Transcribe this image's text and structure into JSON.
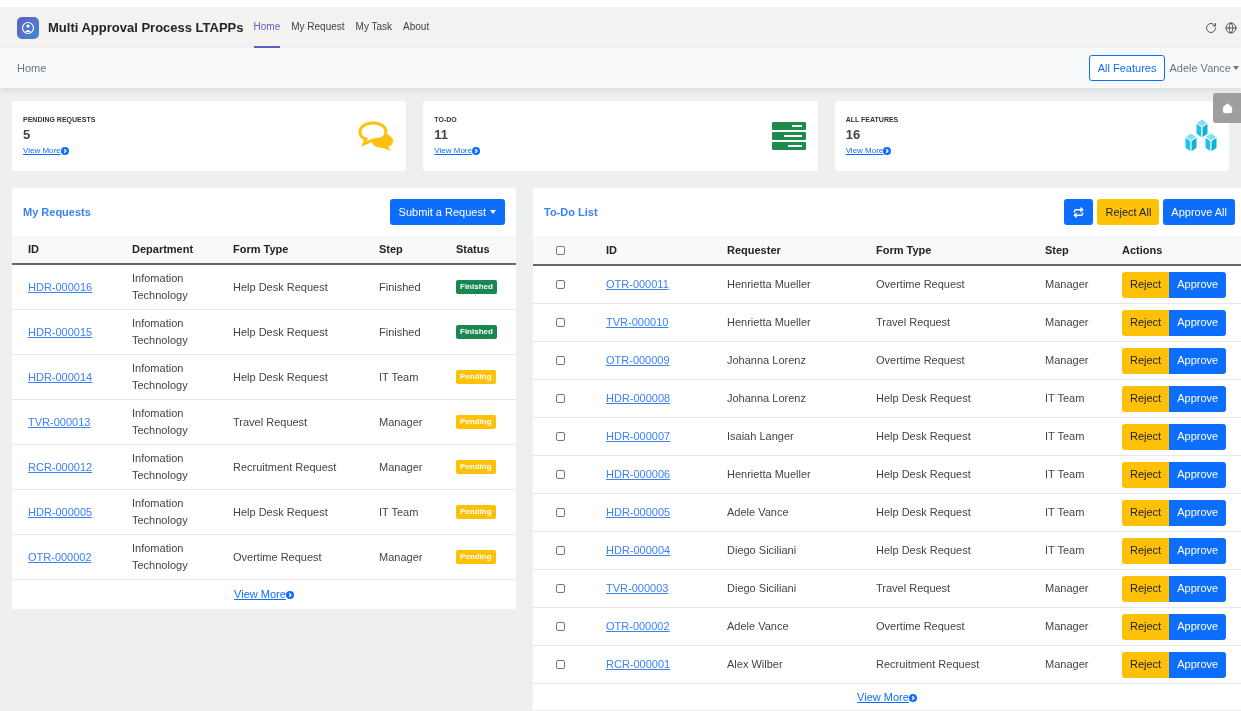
{
  "app": {
    "title": "Multi Approval Process LTAPPs"
  },
  "nav": [
    {
      "label": "Home",
      "selected": true
    },
    {
      "label": "My Request",
      "selected": false
    },
    {
      "label": "My Task",
      "selected": false
    },
    {
      "label": "About",
      "selected": false
    }
  ],
  "breadcrumb": "Home",
  "all_features_button": "All Features",
  "user_menu": "Adele Vance",
  "stats": [
    {
      "kind": "chat",
      "title": "PENDING REQUESTS",
      "value": "5",
      "link": "View More"
    },
    {
      "kind": "list",
      "title": "TO-DO",
      "value": "11",
      "link": "View More"
    },
    {
      "kind": "cubes",
      "title": "ALL FEATURES",
      "value": "16",
      "link": "View More"
    }
  ],
  "my_requests": {
    "title": "My Requests",
    "button": "Submit a Request",
    "columns": [
      "ID",
      "Department",
      "Form Type",
      "Step",
      "Status"
    ],
    "rows": [
      {
        "id": "HDR-000016",
        "department": "Infomation Technology",
        "form_type": "Help Desk Request",
        "step": "Finished",
        "status": {
          "kind": "finished",
          "label": "Finished"
        }
      },
      {
        "id": "HDR-000015",
        "department": "Infomation Technology",
        "form_type": "Help Desk Request",
        "step": "Finished",
        "status": {
          "kind": "finished",
          "label": "Finished"
        }
      },
      {
        "id": "HDR-000014",
        "department": "Infomation Technology",
        "form_type": "Help Desk Request",
        "step": "IT Team",
        "status": {
          "kind": "pending",
          "label": "Pending"
        }
      },
      {
        "id": "TVR-000013",
        "department": "Infomation Technology",
        "form_type": "Travel Request",
        "step": "Manager",
        "status": {
          "kind": "pending",
          "label": "Pending"
        }
      },
      {
        "id": "RCR-000012",
        "department": "Infomation Technology",
        "form_type": "Recruitment Request",
        "step": "Manager",
        "status": {
          "kind": "pending",
          "label": "Pending"
        }
      },
      {
        "id": "HDR-000005",
        "department": "Infomation Technology",
        "form_type": "Help Desk Request",
        "step": "IT Team",
        "status": {
          "kind": "pending",
          "label": "Pending"
        }
      },
      {
        "id": "OTR-000002",
        "department": "Infomation Technology",
        "form_type": "Overtime Request",
        "step": "Manager",
        "status": {
          "kind": "pending",
          "label": "Pending"
        }
      }
    ],
    "view_more": "View More"
  },
  "todo": {
    "title": "To-Do List",
    "reject_all": "Reject All",
    "approve_all": "Approve All",
    "select_all_checked": false,
    "columns": [
      "ID",
      "Requester",
      "Form Type",
      "Step",
      "Actions"
    ],
    "rows": [
      {
        "checked": false,
        "id": "OTR-000011",
        "requester": "Henrietta Mueller",
        "form_type": "Overtime Request",
        "step": "Manager",
        "reject": "Reject",
        "approve": "Approve"
      },
      {
        "checked": false,
        "id": "TVR-000010",
        "requester": "Henrietta Mueller",
        "form_type": "Travel Request",
        "step": "Manager",
        "reject": "Reject",
        "approve": "Approve"
      },
      {
        "checked": false,
        "id": "OTR-000009",
        "requester": "Johanna Lorenz",
        "form_type": "Overtime Request",
        "step": "Manager",
        "reject": "Reject",
        "approve": "Approve"
      },
      {
        "checked": false,
        "id": "HDR-000008",
        "requester": "Johanna Lorenz",
        "form_type": "Help Desk Request",
        "step": "IT Team",
        "reject": "Reject",
        "approve": "Approve"
      },
      {
        "checked": false,
        "id": "HDR-000007",
        "requester": "Isaiah Langer",
        "form_type": "Help Desk Request",
        "step": "IT Team",
        "reject": "Reject",
        "approve": "Approve"
      },
      {
        "checked": false,
        "id": "HDR-000006",
        "requester": "Henrietta Mueller",
        "form_type": "Help Desk Request",
        "step": "IT Team",
        "reject": "Reject",
        "approve": "Approve"
      },
      {
        "checked": false,
        "id": "HDR-000005",
        "requester": "Adele Vance",
        "form_type": "Help Desk Request",
        "step": "IT Team",
        "reject": "Reject",
        "approve": "Approve"
      },
      {
        "checked": false,
        "id": "HDR-000004",
        "requester": "Diego Siciliani",
        "form_type": "Help Desk Request",
        "step": "IT Team",
        "reject": "Reject",
        "approve": "Approve"
      },
      {
        "checked": false,
        "id": "TVR-000003",
        "requester": "Diego Siciliani",
        "form_type": "Travel Request",
        "step": "Manager",
        "reject": "Reject",
        "approve": "Approve"
      },
      {
        "checked": false,
        "id": "OTR-000002",
        "requester": "Adele Vance",
        "form_type": "Overtime Request",
        "step": "Manager",
        "reject": "Reject",
        "approve": "Approve"
      },
      {
        "checked": false,
        "id": "RCR-000001",
        "requester": "Alex Wilber",
        "form_type": "Recruitment Request",
        "step": "Manager",
        "reject": "Reject",
        "approve": "Approve"
      }
    ],
    "view_more": "View More"
  }
}
